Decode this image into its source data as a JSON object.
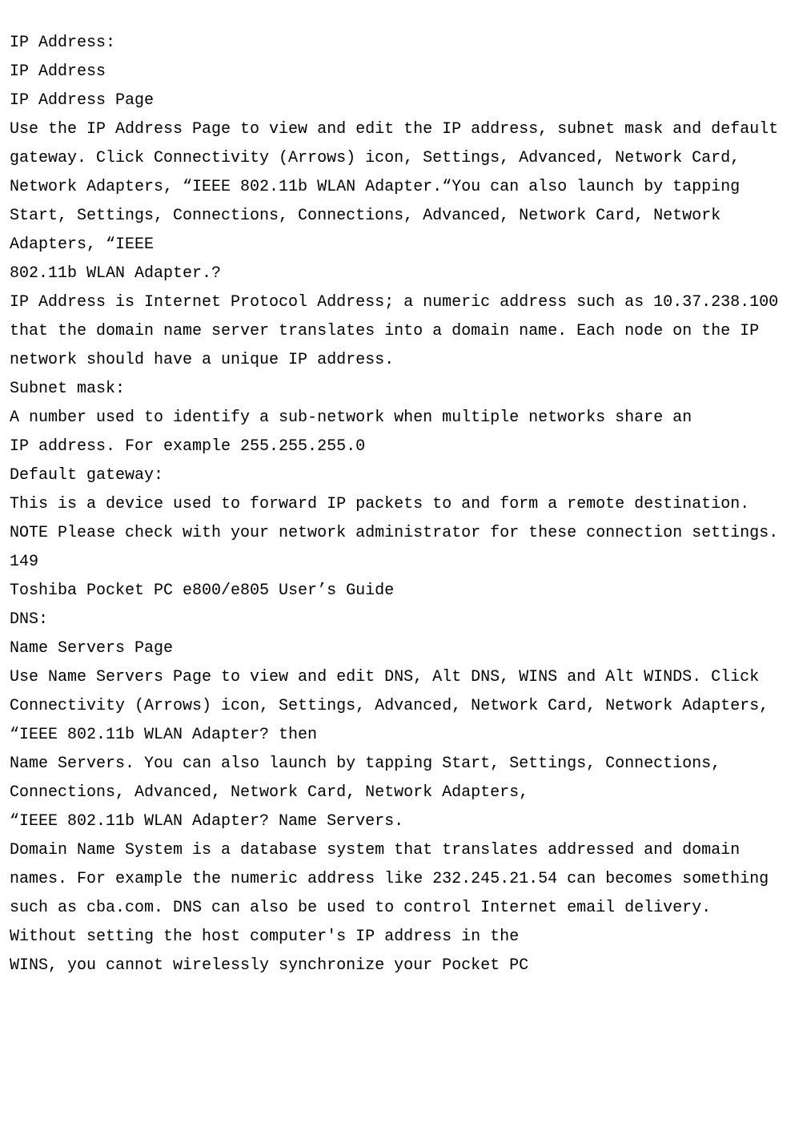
{
  "doc": {
    "lines": [
      "IP Address:",
      "IP Address",
      "IP Address Page",
      "Use the IP Address Page to view and edit the IP address, subnet mask and default gateway. Click Connectivity (Arrows) icon, Settings, Advanced, Network Card, Network Adapters, “IEEE 802.11b WLAN Adapter.“You can also launch by tapping Start, Settings, Connections, Connections, Advanced, Network Card, Network Adapters, “IEEE",
      "802.11b WLAN Adapter.?",
      "IP Address is Internet Protocol Address; a numeric address such as 10.37.238.100 that the domain name server translates into a domain name. Each node on the IP network should have a unique IP address.",
      "Subnet mask:",
      "A number used to identify a sub-network when multiple networks share an",
      "IP address. For example 255.255.255.0",
      "Default gateway:",
      "This is a device used to forward IP packets to and form a remote destination.",
      "NOTE Please check with your network administrator for these connection settings.",
      "149",
      "Toshiba Pocket PC e800/e805 User’s Guide",
      "DNS:",
      "Name Servers Page",
      "Use Name Servers Page to view and edit DNS, Alt DNS, WINS and Alt WINDS. Click Connectivity (Arrows) icon, Settings, Advanced, Network Card, Network Adapters, “IEEE 802.11b WLAN Adapter? then",
      "Name Servers. You can also launch by tapping Start, Settings, Connections,",
      "Connections, Advanced, Network Card, Network Adapters,",
      "“IEEE 802.11b WLAN Adapter? Name Servers.",
      "Domain Name System is a database system that translates addressed and domain names. For example the numeric address like 232.245.21.54 can becomes something such as cba.com. DNS can also be used to control Internet email delivery.",
      "Without setting the host computer's IP address in the",
      "WINS, you cannot wirelessly synchronize your Pocket PC"
    ]
  }
}
